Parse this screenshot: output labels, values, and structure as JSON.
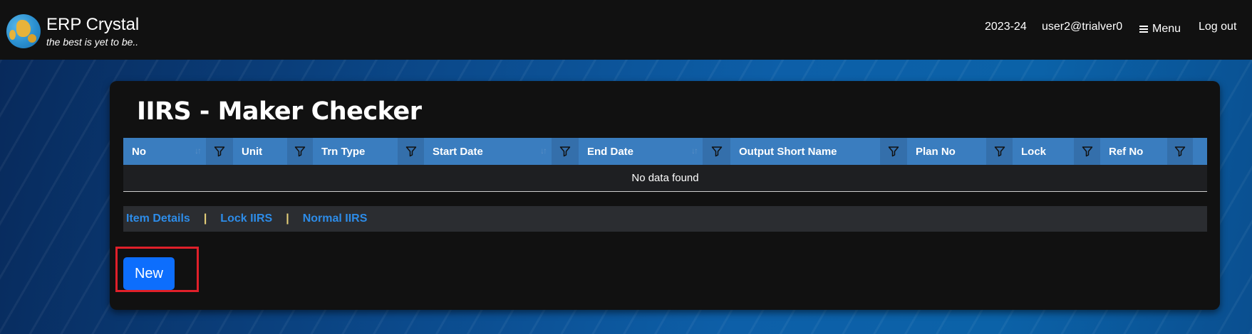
{
  "app": {
    "name": "ERP Crystal",
    "tagline": "the best is yet to be.."
  },
  "navbar": {
    "financial_year": "2023-24",
    "user": "user2@trialver0",
    "menu_label": "Menu",
    "logout_label": "Log out"
  },
  "page": {
    "title": "IIRS - Maker Checker"
  },
  "table": {
    "columns": [
      {
        "label": "No",
        "sortable": true
      },
      {
        "label": "Unit",
        "sortable": false
      },
      {
        "label": "Trn Type",
        "sortable": false
      },
      {
        "label": "Start Date",
        "sortable": true
      },
      {
        "label": "End Date",
        "sortable": true
      },
      {
        "label": "Output Short Name",
        "sortable": false
      },
      {
        "label": "Plan No",
        "sortable": false
      },
      {
        "label": "Lock",
        "sortable": false
      },
      {
        "label": "Ref No",
        "sortable": false
      }
    ],
    "empty_message": "No data found"
  },
  "links": {
    "item_details": "Item Details",
    "lock_iirs": "Lock IIRS",
    "normal_iirs": "Normal IIRS",
    "separator": "|"
  },
  "actions": {
    "new_label": "New"
  },
  "icons": {
    "logo": "globe-logo",
    "menu": "hamburger-icon",
    "filter": "funnel-icon",
    "sort": "sort-arrows-icon"
  },
  "colors": {
    "navbar_bg": "#111111",
    "table_header": "#3a7dbf",
    "link": "#2d8ce8",
    "primary_button": "#0d6efd",
    "highlight_box": "#e0202a"
  }
}
